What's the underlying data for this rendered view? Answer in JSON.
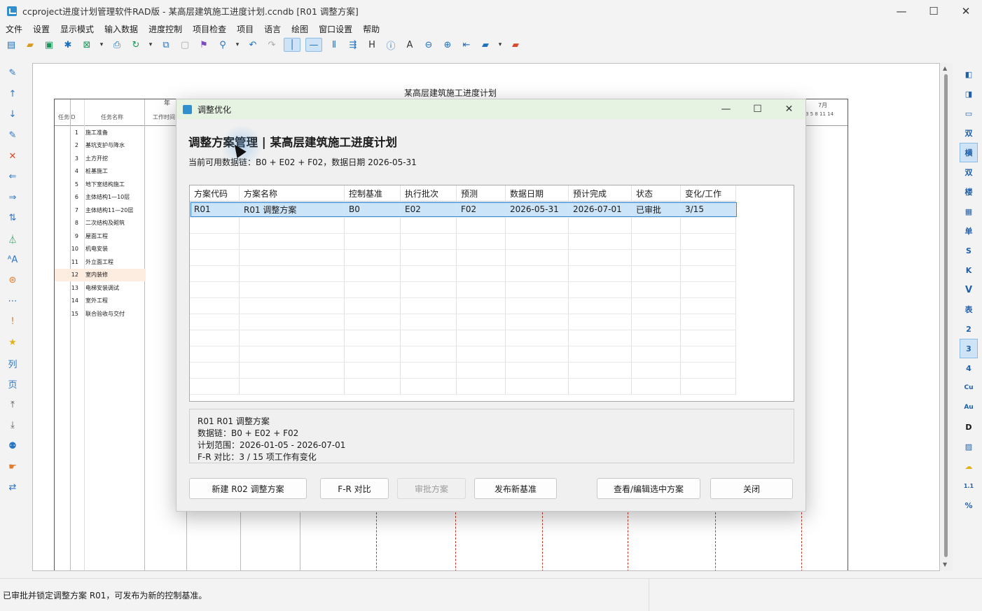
{
  "window": {
    "title": "ccproject进度计划管理软件RAD版 - 某高层建筑施工进度计划.ccndb [R01 调整方案]",
    "controls": {
      "minimize": "—",
      "maximize": "☐",
      "close": "✕"
    }
  },
  "menu": [
    "文件",
    "设置",
    "显示模式",
    "输入数据",
    "进度控制",
    "项目检查",
    "项目",
    "语言",
    "绘图",
    "窗口设置",
    "帮助"
  ],
  "toolbar_glyphs": [
    "▤",
    "▰",
    "▣",
    "✱",
    "⊠",
    "▾",
    "⎙",
    "↻",
    "▾",
    "⧉",
    "▢",
    "⚑",
    "⚲",
    "▾",
    "↶",
    "↷",
    "│",
    "—",
    "⫴",
    "⇶",
    "H",
    "ⓘ",
    "A",
    "⊖",
    "⊕",
    "⇤",
    "▰",
    "▾",
    "▰"
  ],
  "left_tools": [
    "✎",
    "↑",
    "↓",
    "✎",
    "✕",
    "⇐",
    "⇒",
    "⇅",
    "⏃",
    "ᴬA",
    "⊛",
    "⋯",
    "!",
    "★",
    "列",
    "页",
    "⤒",
    "⤓",
    "⚉",
    "☛",
    "⇄"
  ],
  "right_tools": [
    "◧",
    "◨",
    "▭",
    "双",
    "横",
    "双",
    "楼",
    "▦",
    "单",
    "S",
    "K",
    "V",
    "表",
    "2",
    "3",
    "4",
    "Cu",
    "Au",
    "D",
    "▨",
    "☁",
    "1.1",
    "%"
  ],
  "sheet": {
    "title": "某高层建筑施工进度计划",
    "headers": {
      "id": "任务ID",
      "name": "任务名称",
      "duration": "工作时间",
      "month": "7月",
      "days": "3  5  8  11 14",
      "year": "年"
    },
    "tasks": [
      {
        "id": "1",
        "name": "施工准备"
      },
      {
        "id": "2",
        "name": "基坑支护与降水"
      },
      {
        "id": "3",
        "name": "土方开挖"
      },
      {
        "id": "4",
        "name": "桩基施工"
      },
      {
        "id": "5",
        "name": "地下室结构施工"
      },
      {
        "id": "6",
        "name": "主体结构1—10层"
      },
      {
        "id": "7",
        "name": "主体结构11—20层"
      },
      {
        "id": "8",
        "name": "二次结构及砌筑"
      },
      {
        "id": "9",
        "name": "屋面工程"
      },
      {
        "id": "10",
        "name": "机电安装"
      },
      {
        "id": "11",
        "name": "外立面工程"
      },
      {
        "id": "12",
        "name": "室内装修"
      },
      {
        "id": "13",
        "name": "电梯安装调试"
      },
      {
        "id": "14",
        "name": "室外工程"
      },
      {
        "id": "15",
        "name": "联合验收与交付"
      }
    ]
  },
  "dialog": {
    "title": "调整优化",
    "heading": "调整方案管理 | 某高层建筑施工进度计划",
    "subtitle": "当前可用数据链：B0 + E02 + F02，数据日期 2026-05-31",
    "columns": [
      "方案代码",
      "方案名称",
      "控制基准",
      "执行批次",
      "预测",
      "数据日期",
      "预计完成",
      "状态",
      "变化/工作"
    ],
    "rows": [
      {
        "code": "R01",
        "name": "R01 调整方案",
        "baseline": "B0",
        "batch": "E02",
        "forecast": "F02",
        "data_date": "2026-05-31",
        "finish": "2026-07-01",
        "status": "已审批",
        "change": "3/15"
      }
    ],
    "info": [
      "R01  R01 调整方案",
      "数据链：B0 + E02 + F02",
      "计划范围：2026-01-05 - 2026-07-01",
      "F-R 对比：3 / 15 项工作有变化"
    ],
    "buttons": {
      "new": "新建 R02 调整方案",
      "compare": "F-R 对比",
      "approve": "审批方案",
      "publish": "发布新基准",
      "view": "查看/编辑选中方案",
      "close": "关闭"
    }
  },
  "status": {
    "message": "已审批并锁定调整方案 R01，可发布为新的控制基准。"
  }
}
